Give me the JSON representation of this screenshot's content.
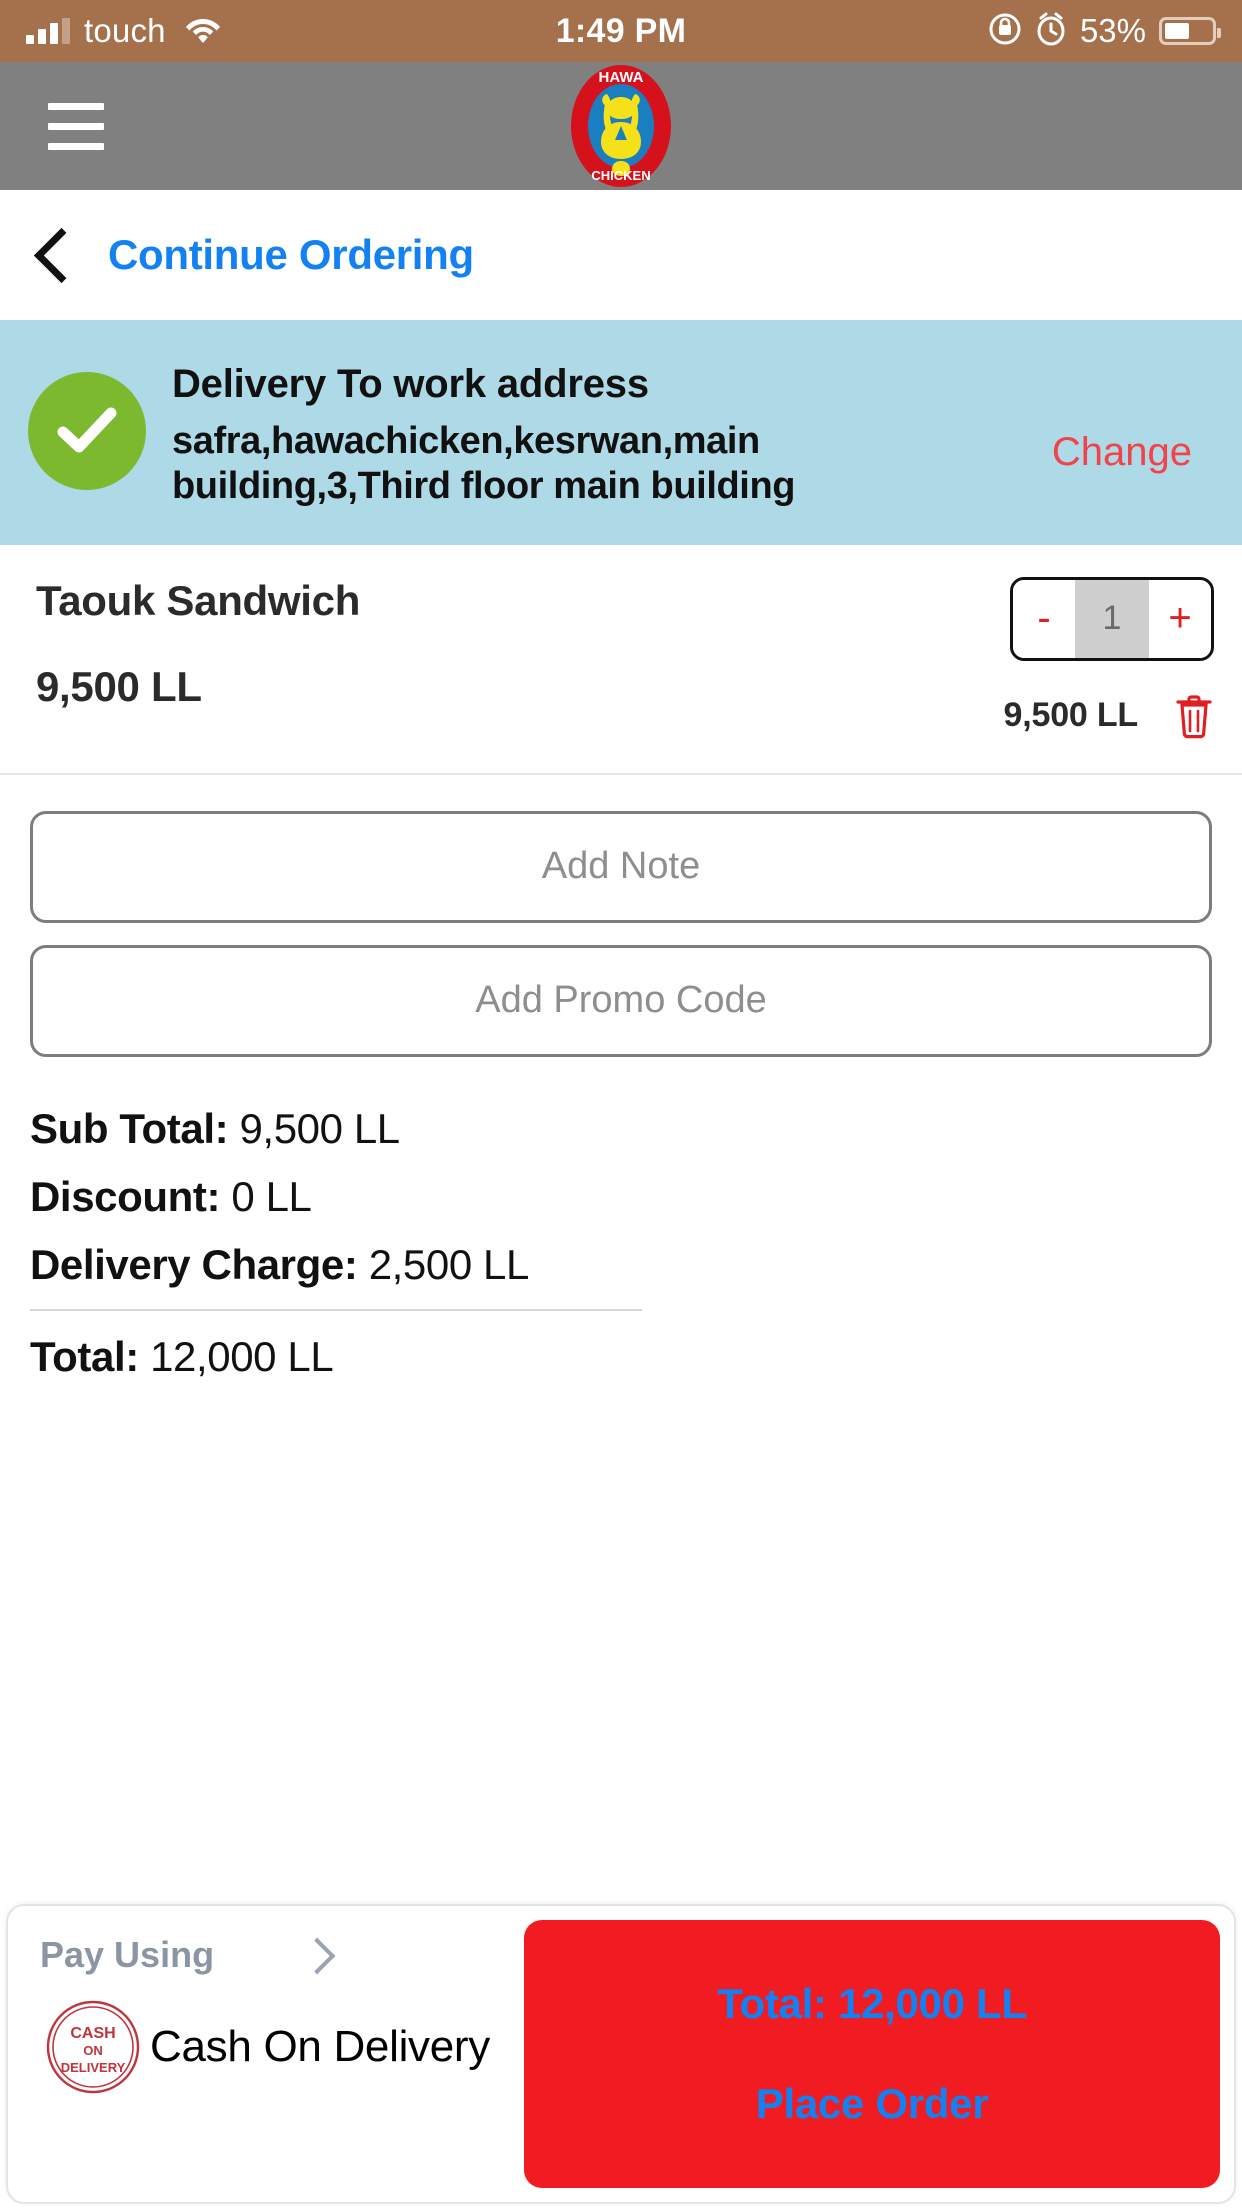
{
  "status_bar": {
    "carrier": "touch",
    "time": "1:49 PM",
    "battery_percent": "53%",
    "icons": [
      "signal-bars-icon",
      "wifi-icon",
      "rotation-lock-icon",
      "alarm-clock-icon",
      "battery-icon"
    ]
  },
  "app_bar": {
    "menu_icon": "hamburger-menu-icon",
    "logo_top_text": "HAWA",
    "logo_bottom_text": "CHICKEN",
    "background": "#808080"
  },
  "nav": {
    "back_icon": "chevron-left-icon",
    "label": "Continue Ordering",
    "color": "#1481f2"
  },
  "delivery": {
    "status_icon": "check-circle-icon",
    "title": "Delivery To work address",
    "address": "safra,hawachicken,kesrwan,main building,3,Third floor main building",
    "change_label": "Change",
    "change_color": "#f0434a",
    "background": "#aed9e6",
    "check_color": "#7cb92e"
  },
  "cart": {
    "items": [
      {
        "name": "Taouk Sandwich",
        "unit_price": "9,500 LL",
        "quantity": "1",
        "line_total": "9,500 LL",
        "decrement_label": "-",
        "increment_label": "+",
        "delete_icon": "trash-icon"
      }
    ]
  },
  "inputs": {
    "note_placeholder": "Add Note",
    "note_value": "",
    "promo_placeholder": "Add Promo Code",
    "promo_value": ""
  },
  "totals": {
    "sub_total_label": "Sub Total:",
    "sub_total_value": "9,500 LL",
    "discount_label": "Discount:",
    "discount_value": "0 LL",
    "delivery_charge_label": "Delivery Charge:",
    "delivery_charge_value": "2,500 LL",
    "total_label": "Total:",
    "total_value": "12,000 LL"
  },
  "payment": {
    "pay_using_label": "Pay Using",
    "chevron_icon": "chevron-right-icon",
    "method_icon": "cash-on-delivery-stamp-icon",
    "method_name": "Cash On Delivery",
    "button_total": "Total: 12,000 LL",
    "button_label": "Place Order",
    "button_color": "#f11b22",
    "button_text_color": "#1481f2"
  }
}
